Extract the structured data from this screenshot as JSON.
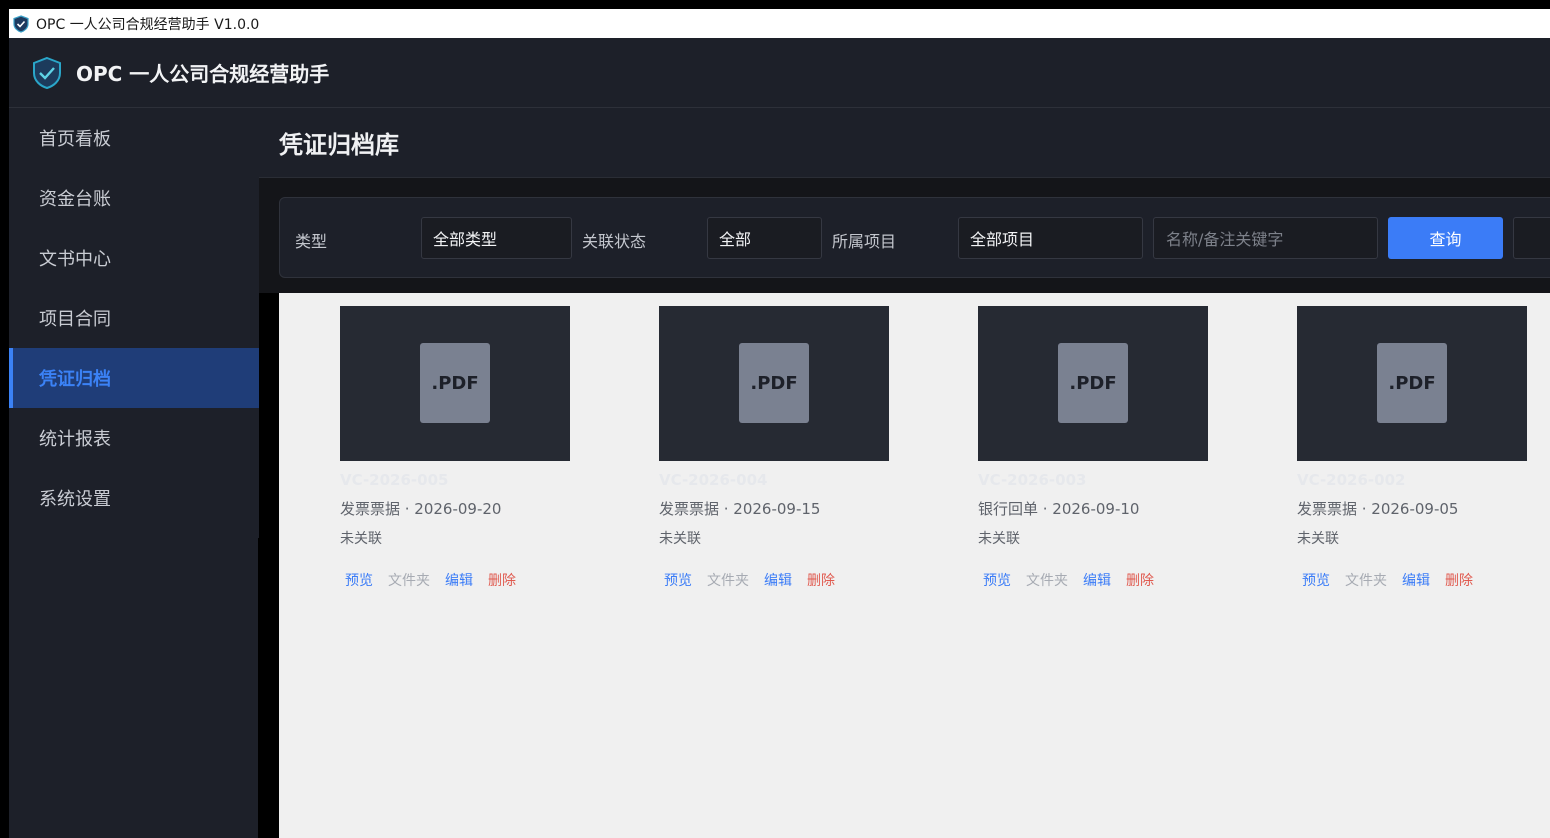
{
  "window": {
    "title": "OPC 一人公司合规经营助手 V1.0.0",
    "icon": "shield-icon"
  },
  "header": {
    "app_name": "OPC 一人公司合规经营助手",
    "logo": "shield-logo-icon"
  },
  "sidebar": {
    "items": [
      {
        "label": "首页看板"
      },
      {
        "label": "资金台账"
      },
      {
        "label": "文书中心"
      },
      {
        "label": "项目合同"
      },
      {
        "label": "凭证归档",
        "active": true
      },
      {
        "label": "统计报表"
      },
      {
        "label": "系统设置"
      }
    ]
  },
  "page": {
    "title": "凭证归档库"
  },
  "filters": {
    "type_label": "类型",
    "type_value": "全部类型",
    "status_label": "关联状态",
    "status_value": "全部",
    "project_label": "所属项目",
    "project_value": "全部项目",
    "keyword_placeholder": "名称/备注关键字",
    "search_button": "查询"
  },
  "cards": [
    {
      "thumb_label": ".PDF",
      "code": "VC-2026-005",
      "meta": "发票票据 · 2026-09-20",
      "status": "未关联"
    },
    {
      "thumb_label": ".PDF",
      "code": "VC-2026-004",
      "meta": "发票票据 · 2026-09-15",
      "status": "未关联"
    },
    {
      "thumb_label": ".PDF",
      "code": "VC-2026-003",
      "meta": "银行回单 · 2026-09-10",
      "status": "未关联"
    },
    {
      "thumb_label": ".PDF",
      "code": "VC-2026-002",
      "meta": "发票票据 · 2026-09-05",
      "status": "未关联"
    }
  ],
  "card_actions": {
    "preview": "预览",
    "folder": "文件夹",
    "edit": "编辑",
    "delete": "删除"
  },
  "colors": {
    "accent": "#3b7cf7",
    "danger": "#e05a4f",
    "sidebar_bg": "#1d2029",
    "active_bg": "#1f3d78"
  }
}
